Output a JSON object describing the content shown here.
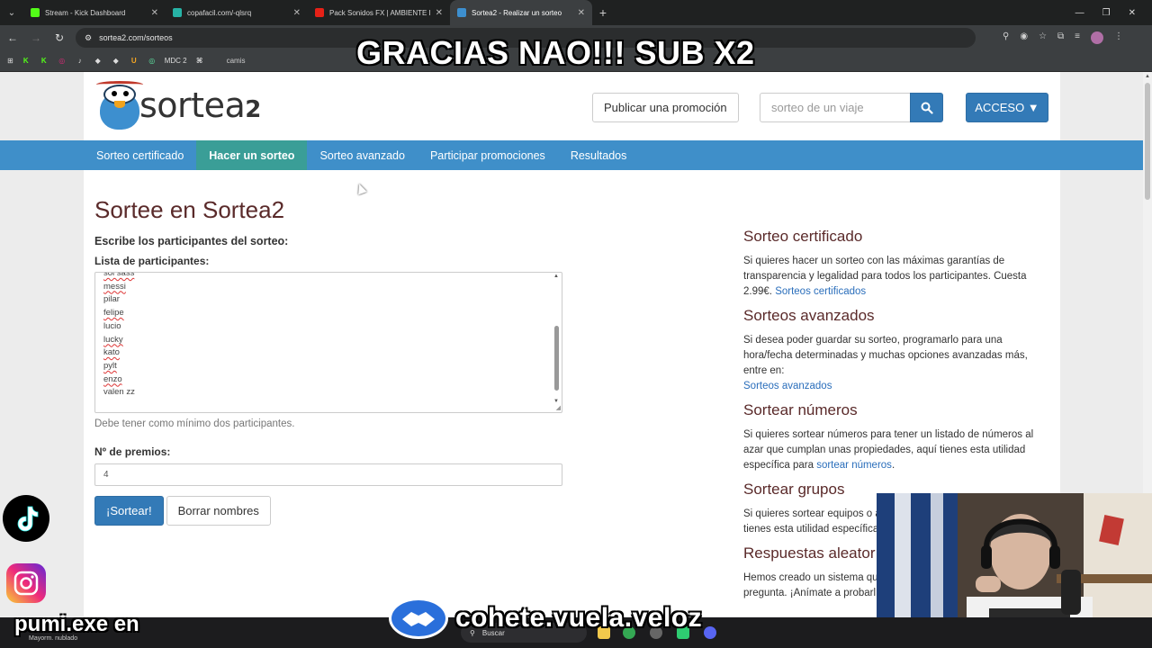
{
  "browser": {
    "tabs": [
      {
        "title": "Stream - Kick Dashboard",
        "favicon_color": "#53fc18",
        "active": false
      },
      {
        "title": "copafacil.com/-qlsrq",
        "favicon_color": "#27b3a6",
        "active": false
      },
      {
        "title": "Pack Sonidos FX | AMBIENTE H",
        "favicon_color": "#e62117",
        "active": false
      },
      {
        "title": "Sortea2 - Realizar un sorteo",
        "favicon_color": "#3d8fcf",
        "active": true
      }
    ],
    "url": "sortea2.com/sorteos",
    "bookmarks": [
      {
        "glyph": "K",
        "color": "#53fc18"
      },
      {
        "glyph": "K",
        "color": "#53fc18"
      },
      {
        "glyph": "◎",
        "color": "#d62976"
      },
      {
        "glyph": "♪",
        "color": "#ffffff"
      },
      {
        "glyph": "◆",
        "color": "#ffffff"
      },
      {
        "glyph": "◆",
        "color": "#ffffff"
      },
      {
        "glyph": "U",
        "color": "#f5a623"
      },
      {
        "glyph": "◎",
        "color": "#5ce1a0"
      },
      {
        "glyph": "MDC 2",
        "color": "#8ecf6a"
      },
      {
        "glyph": "⌘",
        "color": "#ffffff"
      },
      {
        "glyph": "camis",
        "color": "#cccccc"
      }
    ]
  },
  "overlay": {
    "banner": "GRACIAS NAO!!! SUB X2",
    "stream_name": "pumi.exe en",
    "promo": "cohete.vuela.veloz"
  },
  "header": {
    "logo_text": "sortea",
    "logo_suffix": "2",
    "publish_label": "Publicar una promoción",
    "search_placeholder": "sorteo de un viaje",
    "acceso_label": "ACCESO ▼"
  },
  "nav": {
    "items": [
      {
        "label": "Sorteo certificado",
        "active": false
      },
      {
        "label": "Hacer un sorteo",
        "active": true
      },
      {
        "label": "Sorteo avanzado",
        "active": false
      },
      {
        "label": "Participar promociones",
        "active": false
      },
      {
        "label": "Resultados",
        "active": false
      }
    ]
  },
  "main": {
    "title": "Sortee en Sortea2",
    "participants_heading": "Escribe los participantes del sorteo:",
    "list_label": "Lista de participantes:",
    "participants": [
      "sol sass",
      "messi",
      "pilar",
      "felipe",
      "lucio",
      "lucky",
      "kato",
      "pylt",
      "enzo",
      "valen zz"
    ],
    "min_help": "Debe tener como mínimo dos participantes.",
    "prizes_label": "Nº de premios:",
    "prizes_value": "4",
    "draw_label": "¡Sortear!",
    "clear_label": "Borrar nombres"
  },
  "sidebar": {
    "certified_title": "Sorteo certificado",
    "certified_text": "Si quieres hacer un sorteo con las máximas garantías de transparencia y legalidad para todos los participantes. Cuesta 2.99€.",
    "certified_link": "Sorteos certificados",
    "advanced_title": "Sorteos avanzados",
    "advanced_text": "Si desea poder guardar su sorteo, programarlo para una hora/fecha determinadas y muchas opciones avanzadas más, entre en:",
    "advanced_link": "Sorteos avanzados",
    "numbers_title": "Sortear números",
    "numbers_text": "Si quieres sortear números para tener un listado de números al azar que cumplan unas propiedades, aquí tienes esta utilidad específica para",
    "numbers_link": "sortear números",
    "numbers_end": ".",
    "groups_title": "Sortear grupos",
    "groups_text": "Si quieres sortear equipos o a",
    "groups_text2": "tienes esta utilidad específica",
    "answers_title": "Respuestas aleator",
    "answers_text": "Hemos creado un sistema que",
    "answers_text2": "pregunta. ¡Anímate a probarl"
  },
  "taskbar": {
    "weather": "Mayorm. nublado",
    "search_label": "Buscar"
  }
}
